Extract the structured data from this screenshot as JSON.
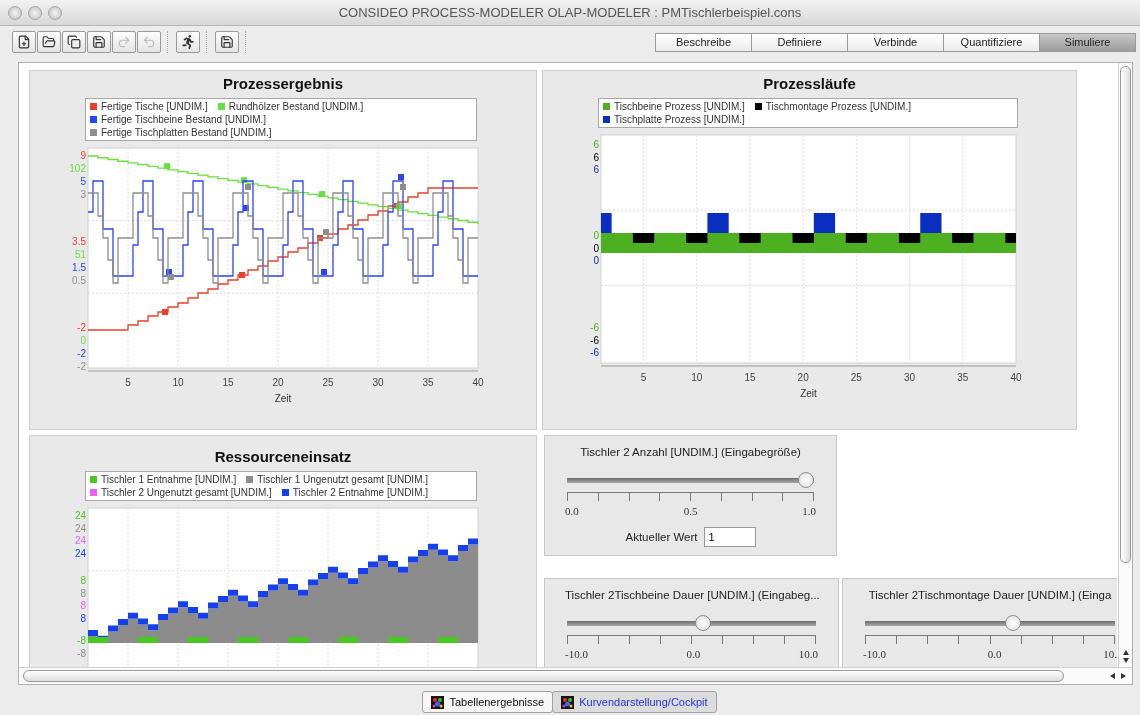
{
  "window": {
    "title": "CONSIDEO PROCESS-MODELER OLAP-MODELER : PMTischlerbeispiel.cons"
  },
  "toolbar_groups": [
    [
      {
        "kind": "new",
        "disabled": false
      },
      {
        "kind": "open",
        "disabled": false
      },
      {
        "kind": "copy",
        "disabled": false
      },
      {
        "kind": "save",
        "disabled": false
      },
      {
        "kind": "redo",
        "disabled": true
      },
      {
        "kind": "undo",
        "disabled": true
      }
    ],
    [
      {
        "kind": "run",
        "disabled": false
      }
    ],
    [
      {
        "kind": "export",
        "disabled": false
      }
    ]
  ],
  "mode_tabs": [
    {
      "label": "Beschreibe",
      "selected": false
    },
    {
      "label": "Definiere",
      "selected": false
    },
    {
      "label": "Verbinde",
      "selected": false
    },
    {
      "label": "Quantifiziere",
      "selected": false
    },
    {
      "label": "Simuliere",
      "selected": true
    }
  ],
  "charts": [
    {
      "title": "Prozessergebnis",
      "kind": "lines",
      "xticks": [
        "5",
        "10",
        "15",
        "20",
        "25",
        "30",
        "35",
        "40"
      ],
      "xlabel": "Zeit",
      "legend_rows": [
        [
          {
            "label": "Fertige Tische [UNDIM.]",
            "color": "#e8402a",
            "axis_labels": [
              "9",
              "3.5",
              "-2"
            ]
          },
          {
            "label": "Rundhölzer Bestand [UNDIM.]",
            "color": "#66e040",
            "axis_labels": [
              "102",
              "51",
              "0"
            ]
          }
        ],
        [
          {
            "label": "Fertige Tischbeine Bestand [UNDIM.]",
            "color": "#2a44f0",
            "axis_labels": [
              "5",
              "1.5",
              "-2"
            ]
          }
        ],
        [
          {
            "label": "Fertige Tischplatten Bestand [UNDIM.]",
            "color": "#8e8e8e",
            "axis_labels": [
              "3",
              "0.5",
              "-2"
            ]
          }
        ]
      ]
    },
    {
      "title": "Prozessläufe",
      "kind": "bars",
      "xticks": [
        "5",
        "10",
        "15",
        "20",
        "25",
        "30",
        "35",
        "40"
      ],
      "xlabel": "Zeit",
      "legend_rows": [
        [
          {
            "label": "Tischbeine Prozess [UNDIM.]",
            "color": "#4cb020",
            "axis_labels": [
              "6",
              "0",
              "-6"
            ]
          },
          {
            "label": "Tischmontage Prozess [UNDIM.]",
            "color": "#000000",
            "axis_labels": [
              "6",
              "0",
              "-6"
            ]
          }
        ],
        [
          {
            "label": "Tischplatte Prozess [UNDIM.]",
            "color": "#0a2ec0",
            "axis_labels": [
              "6",
              "0",
              "-6"
            ]
          }
        ]
      ]
    },
    {
      "title": "Ressourceneinsatz",
      "kind": "area",
      "legend_rows": [
        [
          {
            "label": "Tischler 1 Entnahme [UNDIM.]",
            "color": "#48c820",
            "axis_labels": [
              "24",
              "8",
              "-8"
            ]
          },
          {
            "label": "Tischler 1 Ungenutzt gesamt [UNDIM.]",
            "color": "#8c8c8c",
            "axis_labels": [
              "24",
              "8",
              "-8"
            ]
          }
        ],
        [
          {
            "label": "Tischler 2 Ungenutzt gesamt [UNDIM.]",
            "color": "#f060f0",
            "axis_labels": [
              "24",
              "8"
            ]
          },
          {
            "label": "Tischler 2 Entnahme [UNDIM.]",
            "color": "#1440f0",
            "axis_labels": [
              "24",
              "8"
            ]
          }
        ]
      ]
    }
  ],
  "sliders": [
    {
      "title": "Tischler 2 Anzahl [UNDIM.] (Eingabegröße)",
      "level": 1,
      "tick_labels": [
        "0.0",
        "0.5",
        "1.0"
      ],
      "value_label": "Aktueller Wert",
      "value": "1"
    },
    {
      "title": "Tischler 2Tischbeine Dauer [UNDIM.] (Eingabeg...",
      "level": 0.55,
      "tick_labels": [
        "-10.0",
        "0.0",
        "10.0"
      ]
    },
    {
      "title": "Tischler 2Tischmontage Dauer [UNDIM.] (Einga",
      "level": 0.6,
      "tick_labels": [
        "-10.0",
        "0.0",
        "10."
      ]
    }
  ],
  "bottom_tabs": [
    {
      "label": "Tabellenergebnisse",
      "selected": false
    },
    {
      "label": "Kurvendarstellung/Cockpit",
      "selected": true
    }
  ]
}
